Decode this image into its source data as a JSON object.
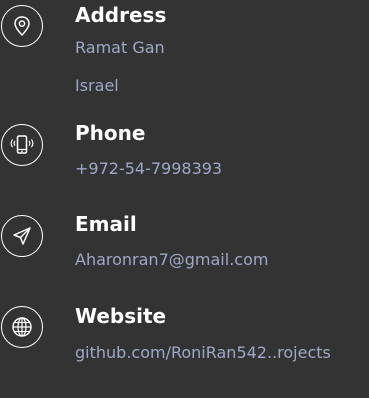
{
  "contact": {
    "address": {
      "icon": "location-pin-icon",
      "title": "Address",
      "line1": "Ramat Gan",
      "line2": "Israel"
    },
    "phone": {
      "icon": "phone-icon",
      "title": "Phone",
      "value": "+972-54-7998393"
    },
    "email": {
      "icon": "paper-plane-icon",
      "title": "Email",
      "value": "Aharonran7@gmail.com"
    },
    "website": {
      "icon": "globe-icon",
      "title": "Website",
      "value": "github.com/RoniRan542..rojects"
    }
  },
  "colors": {
    "background": "#333333",
    "title": "#ffffff",
    "detail": "#9ea8c8",
    "icon": "#ffffff"
  }
}
